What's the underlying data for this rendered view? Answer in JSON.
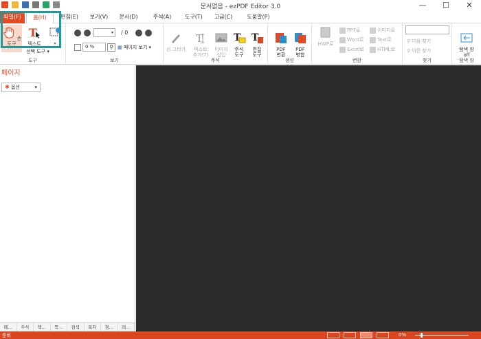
{
  "window": {
    "title": "문서없음 - ezPDF Editor 3.0",
    "minimize": "—",
    "maximize": "☐",
    "close": "✕"
  },
  "menu_tabs": [
    {
      "label": "파일(F)"
    },
    {
      "label": "홈(H)"
    },
    {
      "label": "편집(E)"
    },
    {
      "label": "보기(V)"
    },
    {
      "label": "문서(D)"
    },
    {
      "label": "주석(A)"
    },
    {
      "label": "도구(T)"
    },
    {
      "label": "고급(C)"
    },
    {
      "label": "도움말(P)"
    }
  ],
  "ribbon": {
    "tools": {
      "hand_label": "손 도구",
      "select_label": "선택 도구",
      "text_select_label": "텍스트",
      "group_label": "도구"
    },
    "view": {
      "page_total": "/ 0",
      "zoom_value": "0 %",
      "page_view_label": "페이지 보기",
      "group_label": "보기"
    },
    "annot": {
      "line_draw": "선 그리기",
      "text_add": "텍스트\n추가(T)",
      "image_insert": "이미지\n삽입",
      "annot_tools": "주석\n도구",
      "edit_tools": "편집\n도구",
      "group_label": "주석"
    },
    "create": {
      "pdf_convert": "PDF\n변환",
      "pdf_merge": "PDF\n병합",
      "group_label": "생성"
    },
    "convert": {
      "hwp": "HWP로",
      "ppt": "PPT로",
      "word": "Word로",
      "excel": "Excel로",
      "image": "이미지로",
      "text": "Text로",
      "html": "HTML로",
      "group_label": "변환"
    },
    "find": {
      "next": "다음 찾기",
      "prev": "이전 찾기",
      "group_label": "찾기"
    },
    "nav": {
      "label": "탐색 창\noff",
      "group_label": "탐색 창"
    }
  },
  "left_panel": {
    "title": "페이지",
    "options_label": "옵션",
    "tabs": [
      "페...",
      "주석",
      "책...",
      "쪽...",
      "검색",
      "목차",
      "첨...",
      "레..."
    ]
  },
  "status": {
    "text": "준비",
    "zoom": "0%"
  },
  "colors": {
    "accent": "#e34a24",
    "highlight": "#1e9a9a",
    "document_bg": "#2b2b2b"
  }
}
